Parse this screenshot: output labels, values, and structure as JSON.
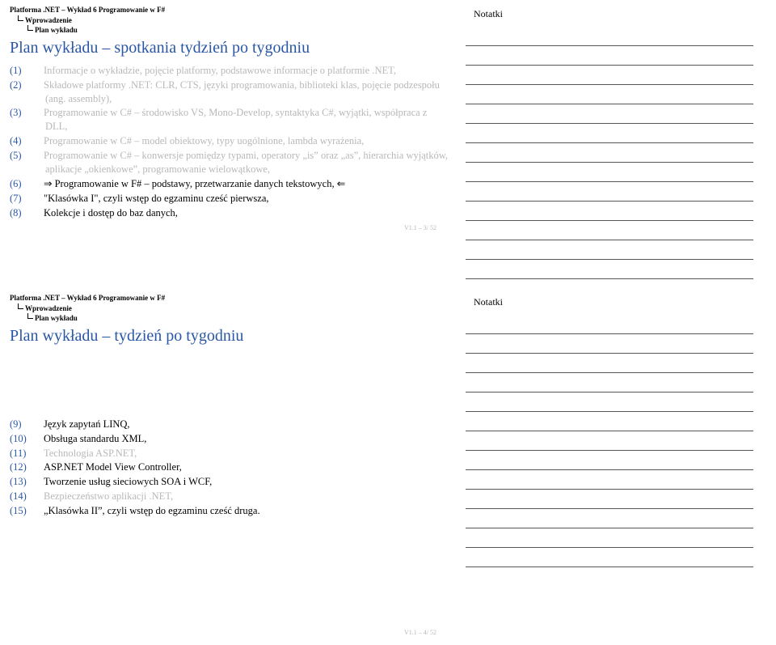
{
  "crumbs": {
    "l0": "Platforma .NET – Wykład 6  Programowanie w F#",
    "l1": "Wprowadzenie",
    "l2": "Plan wykładu"
  },
  "notes_label": "Notatki",
  "slide1": {
    "title": "Plan wykładu – spotkania tydzień po tygodniu",
    "items": [
      {
        "n": "(1)",
        "t": "Informacje o wykładzie, pojęcie platformy, podstawowe informacje o platformie .NET,",
        "cls": "muted"
      },
      {
        "n": "(2)",
        "t": "Składowe platformy .NET: CLR, CTS, języki programowania, biblioteki klas, pojęcie podzespołu (ang. assembly),",
        "cls": "muted"
      },
      {
        "n": "(3)",
        "t": "Programowanie w C# – środowisko VS, Mono-Develop, syntaktyka C#, wyjątki, współpraca z DLL,",
        "cls": "muted"
      },
      {
        "n": "(4)",
        "t": "Programowanie w C# – model obiektowy, typy uogólnione, lambda wyrażenia,",
        "cls": "muted"
      },
      {
        "n": "(5)",
        "t": "Programowanie w C# – konwersje pomiędzy typami, operatory „is” oraz „as”, hierarchia wyjątków, aplikacje „okienkowe”, programowanie wielowątkowe,",
        "cls": "muted"
      },
      {
        "n": "(6)",
        "t": "⇒ Programowanie w F# – podstawy, przetwarzanie danych tekstowych, ⇐",
        "cls": "active"
      },
      {
        "n": "(7)",
        "t": "\"Klasówka I\", czyli wstęp do egzaminu cześć pierwsza,",
        "cls": "active"
      },
      {
        "n": "(8)",
        "t": "Kolekcje i dostęp do baz danych,",
        "cls": "active"
      }
    ],
    "footer": "V1.1 – 3/ 52"
  },
  "slide2": {
    "title": "Plan wykładu – tydzień po tygodniu",
    "items": [
      {
        "n": "(9)",
        "t": "Język zapytań LINQ,",
        "cls": "active"
      },
      {
        "n": "(10)",
        "t": "Obsługa standardu XML,",
        "cls": "active"
      },
      {
        "n": "(11)",
        "t": "Technologia ASP.NET,",
        "cls": "muted"
      },
      {
        "n": "(12)",
        "t": "ASP.NET Model View Controller,",
        "cls": "active"
      },
      {
        "n": "(13)",
        "t": "Tworzenie usług sieciowych SOA i WCF,",
        "cls": "active"
      },
      {
        "n": "(14)",
        "t": "Bezpieczeństwo aplikacji .NET,",
        "cls": "muted"
      },
      {
        "n": "(15)",
        "t": "„Klasówka II”, czyli wstęp do egzaminu cześć druga.",
        "cls": "active"
      }
    ],
    "footer": "V1.1 – 4/ 52"
  }
}
